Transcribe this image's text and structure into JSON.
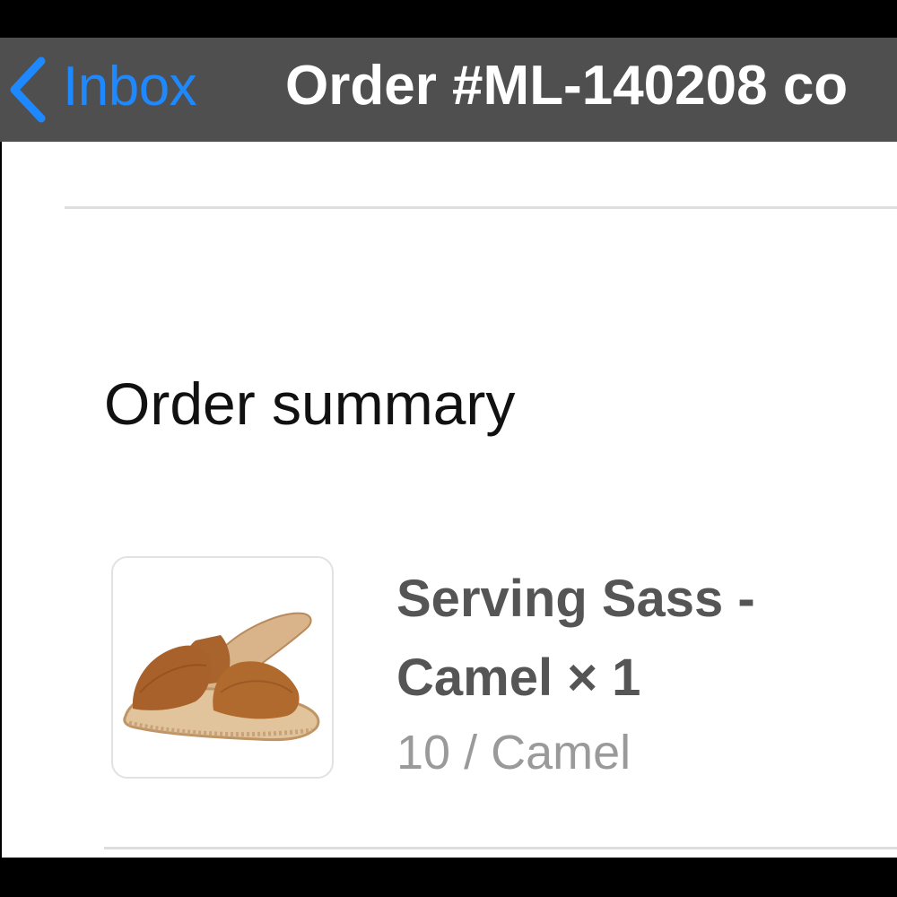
{
  "nav": {
    "back_label": "Inbox",
    "title": "Order #ML-140208 co"
  },
  "order_summary": {
    "heading": "Order summary",
    "items": [
      {
        "name": "Serving Sass - Camel × 1",
        "variant": "10 / Camel",
        "image_icon": "sandal-product-image"
      }
    ]
  },
  "colors": {
    "nav_background": "#4f4f4f",
    "accent": "#1e88ff",
    "item_name": "#555555",
    "item_variant": "#9a9a9a"
  }
}
